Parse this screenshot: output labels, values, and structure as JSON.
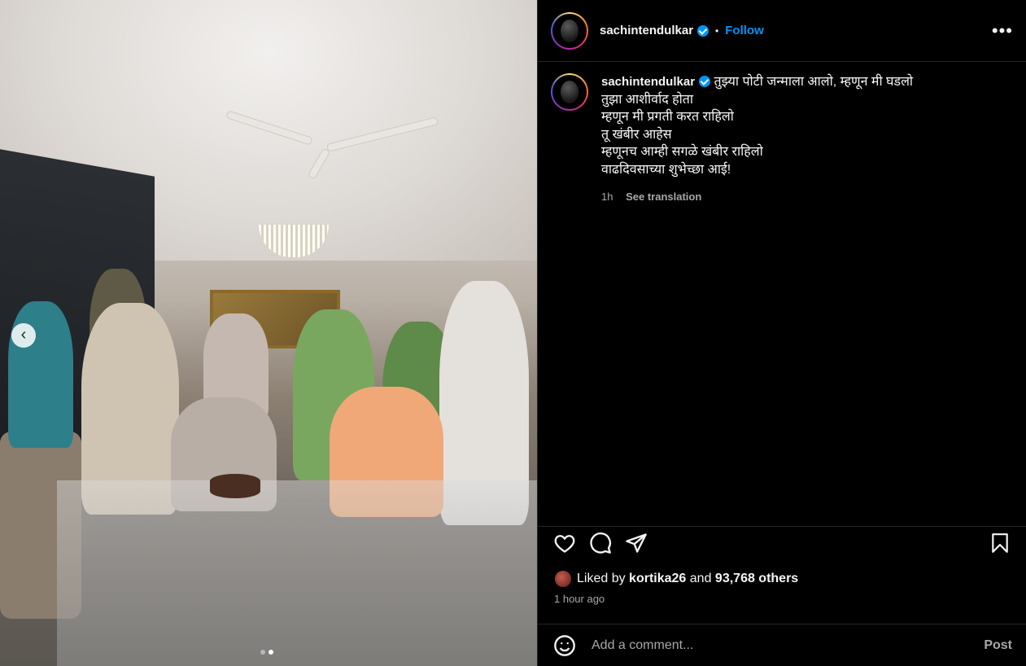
{
  "post": {
    "username": "sachintendulkar",
    "separator": "•",
    "follow_label": "Follow",
    "more_label": "•••",
    "caption": "तुझ्या पोटी जन्माला आलो, म्हणून मी घडलो\nतुझा आशीर्वाद होता\nम्हणून मी प्रगती करत राहिलो\nतू खंबीर आहेस\nम्हणूनच आम्ही सगळे खंबीर राहिलो\nवाढदिवसाच्या शुभेच्छा आई!",
    "caption_age": "1h",
    "see_translation": "See translation",
    "likes_prefix": "Liked by",
    "liked_by_user": "kortika26",
    "likes_and": "and",
    "likes_others": "93,768 others",
    "posted_time": "1 hour ago",
    "comment_placeholder": "Add a comment...",
    "post_label": "Post"
  },
  "carousel": {
    "prev_symbol": "‹",
    "slide_count": 2,
    "active_slide": 2
  },
  "colors": {
    "accent": "#0095f6",
    "background": "#000000",
    "secondary_text": "#a8a8a8"
  },
  "icons": [
    "chevron-left-icon",
    "verified-icon",
    "more-icon",
    "heart-icon",
    "comment-icon",
    "share-icon",
    "bookmark-icon",
    "emoji-icon"
  ]
}
